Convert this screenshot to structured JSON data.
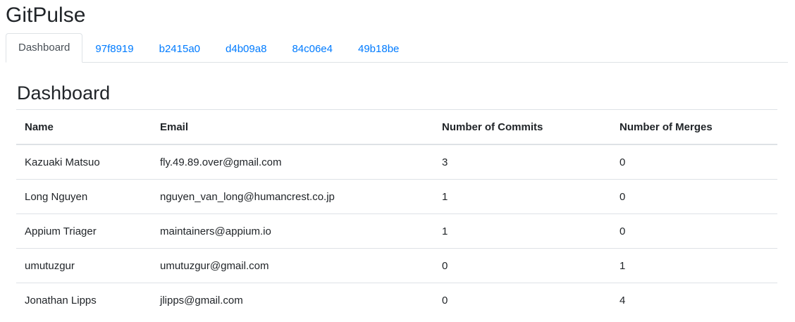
{
  "app": {
    "title": "GitPulse"
  },
  "tabs": [
    {
      "label": "Dashboard",
      "active": true
    },
    {
      "label": "97f8919",
      "active": false
    },
    {
      "label": "b2415a0",
      "active": false
    },
    {
      "label": "d4b09a8",
      "active": false
    },
    {
      "label": "84c06e4",
      "active": false
    },
    {
      "label": "49b18be",
      "active": false
    }
  ],
  "main": {
    "title": "Dashboard",
    "table": {
      "headers": [
        "Name",
        "Email",
        "Number of Commits",
        "Number of Merges"
      ],
      "rows": [
        [
          "Kazuaki Matsuo",
          "fly.49.89.over@gmail.com",
          "3",
          "0"
        ],
        [
          "Long Nguyen",
          "nguyen_van_long@humancrest.co.jp",
          "1",
          "0"
        ],
        [
          "Appium Triager",
          "maintainers@appium.io",
          "1",
          "0"
        ],
        [
          "umutuzgur",
          "umutuzgur@gmail.com",
          "0",
          "1"
        ],
        [
          "Jonathan Lipps",
          "jlipps@gmail.com",
          "0",
          "4"
        ]
      ]
    }
  },
  "colors": {
    "link": "#007bff",
    "active_tab_text": "#495057",
    "text": "#212529",
    "border": "#dee2e6"
  }
}
